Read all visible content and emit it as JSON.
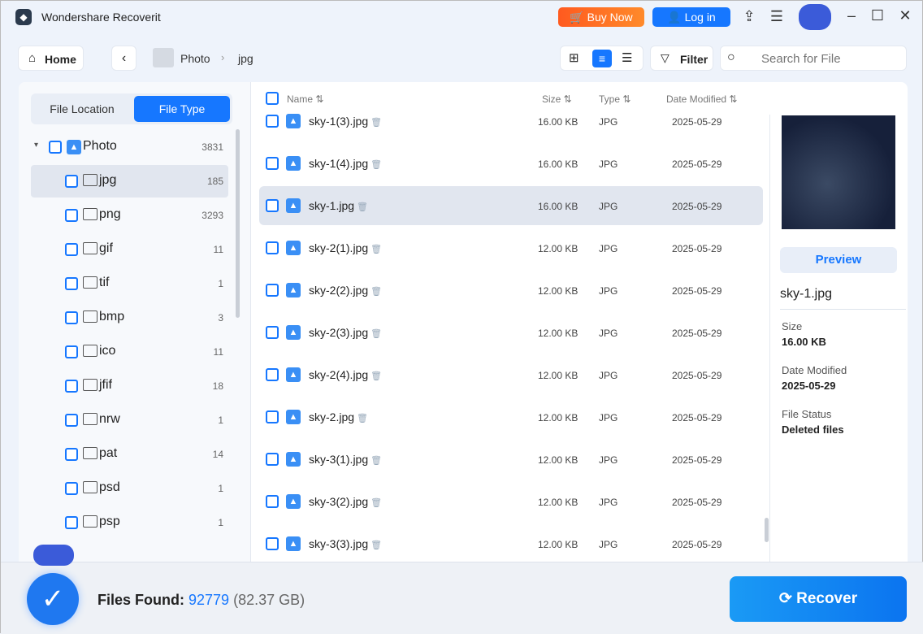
{
  "app": {
    "title": "Wondershare Recoverit",
    "buy_now": "Buy Now",
    "login": "Log in"
  },
  "toolbar": {
    "home": "Home",
    "breadcrumb": [
      "Photo",
      "jpg"
    ],
    "filter": "Filter",
    "search_placeholder": "Search for File"
  },
  "sidebar": {
    "tabs": [
      "File Location",
      "File Type"
    ],
    "root": {
      "label": "Photo",
      "count": "3831"
    },
    "items": [
      {
        "label": "jpg",
        "count": "185"
      },
      {
        "label": "png",
        "count": "3293"
      },
      {
        "label": "gif",
        "count": "11"
      },
      {
        "label": "tif",
        "count": "1"
      },
      {
        "label": "bmp",
        "count": "3"
      },
      {
        "label": "ico",
        "count": "11"
      },
      {
        "label": "jfif",
        "count": "18"
      },
      {
        "label": "nrw",
        "count": "1"
      },
      {
        "label": "pat",
        "count": "14"
      },
      {
        "label": "psd",
        "count": "1"
      },
      {
        "label": "psp",
        "count": "1"
      }
    ]
  },
  "list": {
    "columns": [
      "Name",
      "Size",
      "Type",
      "Date Modified"
    ],
    "rows": [
      {
        "name": "sky-1(3).jpg",
        "size": "16.00 KB",
        "type": "JPG",
        "date": "2025-05-29"
      },
      {
        "name": "sky-1(4).jpg",
        "size": "16.00 KB",
        "type": "JPG",
        "date": "2025-05-29"
      },
      {
        "name": "sky-1.jpg",
        "size": "16.00 KB",
        "type": "JPG",
        "date": "2025-05-29"
      },
      {
        "name": "sky-2(1).jpg",
        "size": "12.00 KB",
        "type": "JPG",
        "date": "2025-05-29"
      },
      {
        "name": "sky-2(2).jpg",
        "size": "12.00 KB",
        "type": "JPG",
        "date": "2025-05-29"
      },
      {
        "name": "sky-2(3).jpg",
        "size": "12.00 KB",
        "type": "JPG",
        "date": "2025-05-29"
      },
      {
        "name": "sky-2(4).jpg",
        "size": "12.00 KB",
        "type": "JPG",
        "date": "2025-05-29"
      },
      {
        "name": "sky-2.jpg",
        "size": "12.00 KB",
        "type": "JPG",
        "date": "2025-05-29"
      },
      {
        "name": "sky-3(1).jpg",
        "size": "12.00 KB",
        "type": "JPG",
        "date": "2025-05-29"
      },
      {
        "name": "sky-3(2).jpg",
        "size": "12.00 KB",
        "type": "JPG",
        "date": "2025-05-29"
      },
      {
        "name": "sky-3(3).jpg",
        "size": "12.00 KB",
        "type": "JPG",
        "date": "2025-05-29"
      }
    ]
  },
  "preview": {
    "button": "Preview",
    "filename": "sky-1.jpg",
    "size_label": "Size",
    "size": "16.00 KB",
    "date_label": "Date Modified",
    "date": "2025-05-29",
    "status_label": "File Status",
    "status": "Deleted files"
  },
  "footer": {
    "label": "Files Found:",
    "count": "92779",
    "size": "(82.37 GB)",
    "recover": "Recover"
  }
}
